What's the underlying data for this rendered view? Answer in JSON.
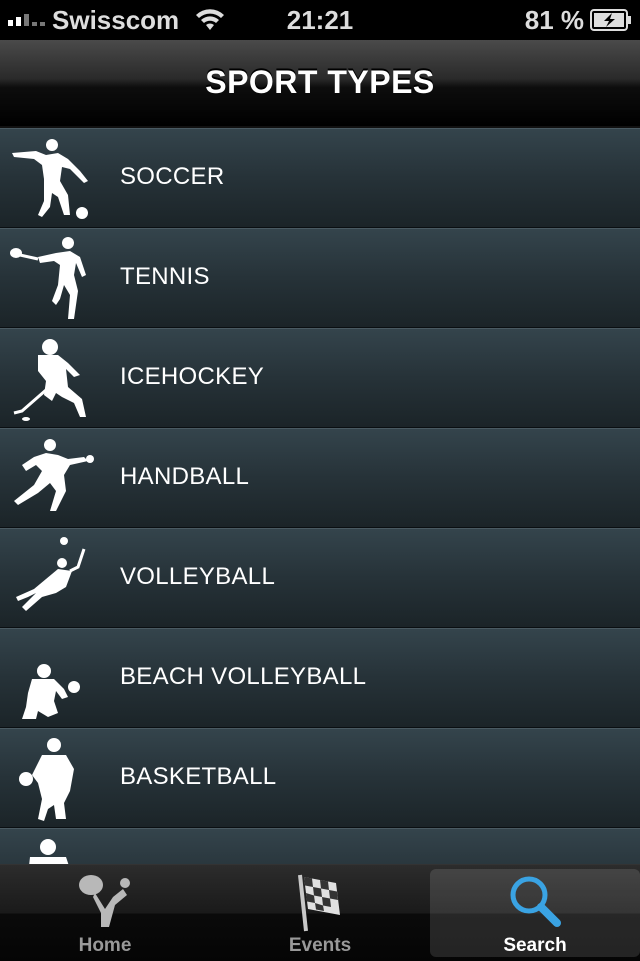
{
  "status_bar": {
    "carrier": "Swisscom",
    "time": "21:21",
    "battery_percent": "81 %"
  },
  "nav": {
    "title": "SPORT TYPES"
  },
  "sports": [
    {
      "label": "SOCCER",
      "icon": "soccer-player-icon"
    },
    {
      "label": "TENNIS",
      "icon": "tennis-player-icon"
    },
    {
      "label": "ICEHOCKEY",
      "icon": "icehockey-player-icon"
    },
    {
      "label": "HANDBALL",
      "icon": "handball-player-icon"
    },
    {
      "label": "VOLLEYBALL",
      "icon": "volleyball-player-icon"
    },
    {
      "label": "BEACH VOLLEYBALL",
      "icon": "beach-volleyball-player-icon"
    },
    {
      "label": "BASKETBALL",
      "icon": "basketball-player-icon"
    },
    {
      "label": "",
      "icon": "football-player-icon"
    }
  ],
  "tabs": [
    {
      "label": "Home",
      "icon": "home-figure-icon",
      "active": false
    },
    {
      "label": "Events",
      "icon": "checkered-flag-icon",
      "active": false
    },
    {
      "label": "Search",
      "icon": "search-icon",
      "active": true
    }
  ],
  "colors": {
    "row_top": "#34444c",
    "row_bottom": "#1b2428",
    "search_accent": "#3aa3e3"
  }
}
